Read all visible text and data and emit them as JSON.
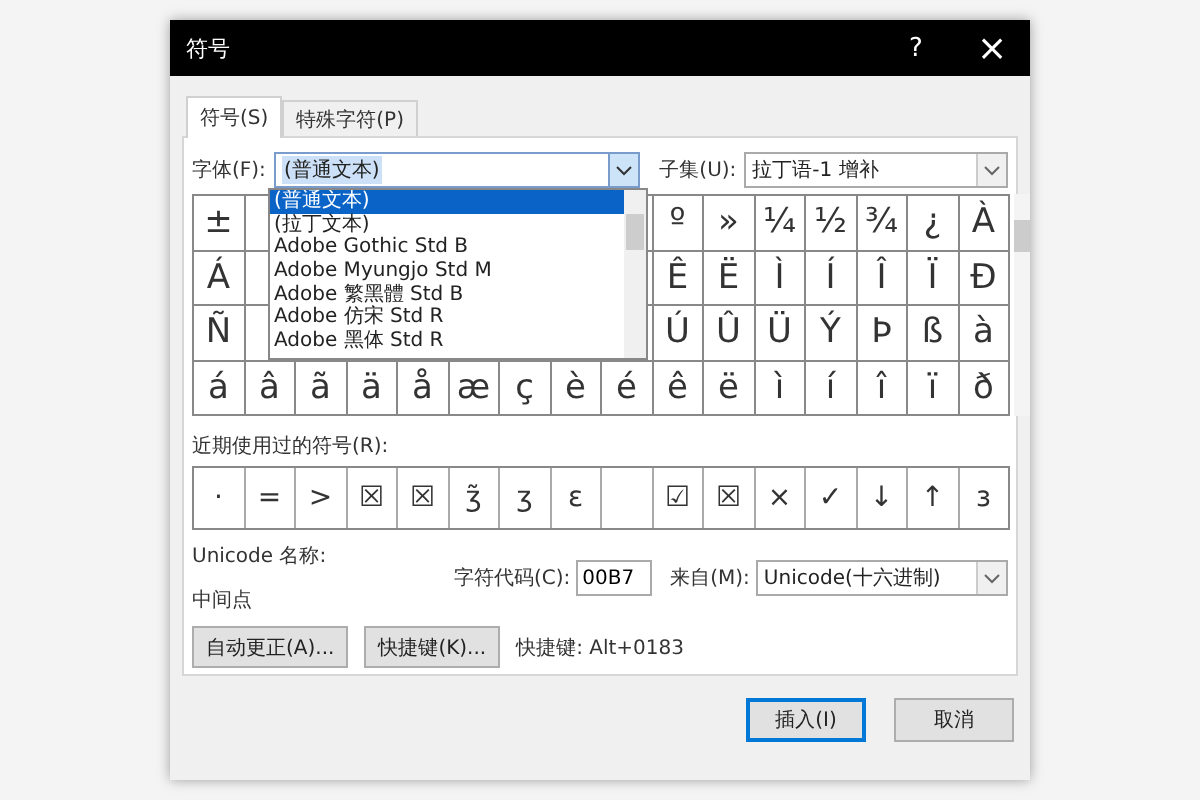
{
  "window": {
    "title": "符号",
    "help": "?",
    "close": "×"
  },
  "tabs": [
    {
      "label": "符号(S)",
      "selected": true
    },
    {
      "label": "特殊字符(P)",
      "selected": false
    }
  ],
  "font": {
    "label": "字体(F):",
    "value": "(普通文本)"
  },
  "subset": {
    "label": "子集(U):",
    "value": "拉丁语-1 增补"
  },
  "font_list": [
    {
      "label": "(普通文本)",
      "selected": true
    },
    {
      "label": "(拉丁文本)",
      "selected": false
    },
    {
      "label": "Adobe Gothic Std B",
      "selected": false
    },
    {
      "label": "Adobe Myungjo Std M",
      "selected": false
    },
    {
      "label": "Adobe 繁黑體 Std B",
      "selected": false
    },
    {
      "label": "Adobe 仿宋 Std R",
      "selected": false
    },
    {
      "label": "Adobe 黑体 Std R",
      "selected": false
    }
  ],
  "symbol_grid": [
    {
      "start": [
        "±"
      ],
      "end": [
        "º",
        "»",
        "¼",
        "½",
        "¾",
        "¿",
        "À"
      ]
    },
    {
      "start": [
        "Á"
      ],
      "end": [
        "Ê",
        "Ë",
        "Ì",
        "Í",
        "Î",
        "Ï",
        "Ð"
      ]
    },
    {
      "start": [
        "Ñ"
      ],
      "end": [
        "Ú",
        "Û",
        "Ü",
        "Ý",
        "Þ",
        "ß",
        "à"
      ]
    },
    {
      "start": [
        "á",
        "â",
        "ã",
        "ä",
        "å",
        "æ",
        "ç",
        "è",
        "é",
        "ê",
        "ë",
        "ì",
        "í",
        "î",
        "ï",
        "ð"
      ]
    }
  ],
  "recent": {
    "label": "近期使用过的符号(R):",
    "symbols": [
      {
        "kind": "symbol",
        "symbol": "·"
      },
      {
        "kind": "symbol",
        "symbol": "="
      },
      {
        "kind": "symbol",
        "symbol": ">"
      },
      {
        "kind": "symbol",
        "symbol": "☒"
      },
      {
        "kind": "symbol",
        "symbol": "☒"
      },
      {
        "kind": "symbol",
        "symbol": "ʒ̃"
      },
      {
        "kind": "symbol",
        "symbol": "ʒ"
      },
      {
        "kind": "symbol",
        "symbol": "ɛ"
      },
      {
        "kind": "blank"
      },
      {
        "kind": "symbol",
        "symbol": "☑"
      },
      {
        "kind": "symbol",
        "symbol": "☒"
      },
      {
        "kind": "symbol",
        "symbol": "×"
      },
      {
        "kind": "symbol",
        "symbol": "✓"
      },
      {
        "kind": "symbol",
        "symbol": "↓"
      },
      {
        "kind": "symbol",
        "symbol": "↑"
      },
      {
        "kind": "symbol",
        "symbol": "з"
      }
    ]
  },
  "unicode_name": {
    "label": "Unicode 名称:",
    "value": "中间点"
  },
  "char_code": {
    "label": "字符代码(C):",
    "value": "00B7"
  },
  "from": {
    "label": "来自(M):",
    "value": "Unicode(十六进制)"
  },
  "action_buttons": [
    "自动更正(A)...",
    "快捷键(K)..."
  ],
  "shortcut": "快捷键: Alt+0183",
  "footer_buttons": [
    {
      "label": "插入(I)",
      "default": true
    },
    {
      "label": "取消",
      "default": false
    }
  ]
}
